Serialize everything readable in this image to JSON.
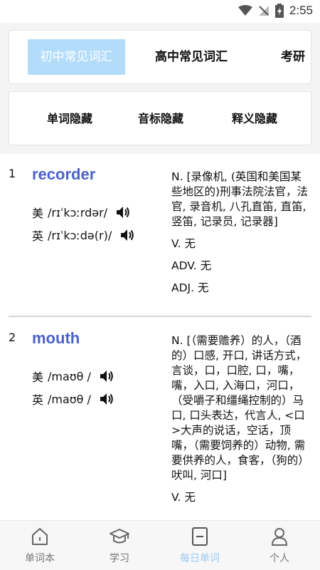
{
  "status_bar": {
    "time": "2:55"
  },
  "category_tabs": [
    {
      "label": "初中常见词汇",
      "active": true
    },
    {
      "label": "高中常见词汇",
      "active": false
    },
    {
      "label": "考研",
      "active": false
    }
  ],
  "toggles": [
    {
      "label": "单词隐藏"
    },
    {
      "label": "音标隐藏"
    },
    {
      "label": "释义隐藏"
    }
  ],
  "words": [
    {
      "index": "1",
      "word": "recorder",
      "us_label": "美",
      "us_phonetic": "/rɪˈkɔːrdər/",
      "uk_label": "英",
      "uk_phonetic": "/rɪˈkɔːdə(r)/",
      "meanings": [
        "N. [录像机, (英国和美国某些地区的)刑事法院法官，法官, 录音机, 八孔直笛, 直笛, 竖笛, 记录员, 记录器]",
        "V. 无",
        "ADV. 无",
        "ADJ. 无"
      ]
    },
    {
      "index": "2",
      "word": "mouth",
      "us_label": "美",
      "us_phonetic": "/maʊθ /",
      "uk_label": "英",
      "uk_phonetic": "/maʊθ /",
      "meanings": [
        "N. [（需要赡养）的人，（酒的）口感, 开口, 讲话方式，言谈，口，口腔, 口，嘴，嘴，入口, 入海口，河口，（受嚼子和缰绳控制的）马口, 口头表达，代言人, <口>大声的说话，空话，顶嘴，（需要饲养的）动物, 需要供养的人，食客，（狗的）吠叫, 河口]",
        "V. 无"
      ]
    }
  ],
  "bottom_nav": [
    {
      "label": "单词本",
      "icon": "home-icon",
      "active": false
    },
    {
      "label": "学习",
      "icon": "graduation-cap-icon",
      "active": false
    },
    {
      "label": "每日单词",
      "icon": "daily-card-icon",
      "active": true
    },
    {
      "label": "个人",
      "icon": "person-icon",
      "active": false
    }
  ],
  "colors": {
    "accent": "#4a62c9",
    "active_tab_bg": "#b3dcfb",
    "nav_active": "#9ccaf2"
  }
}
